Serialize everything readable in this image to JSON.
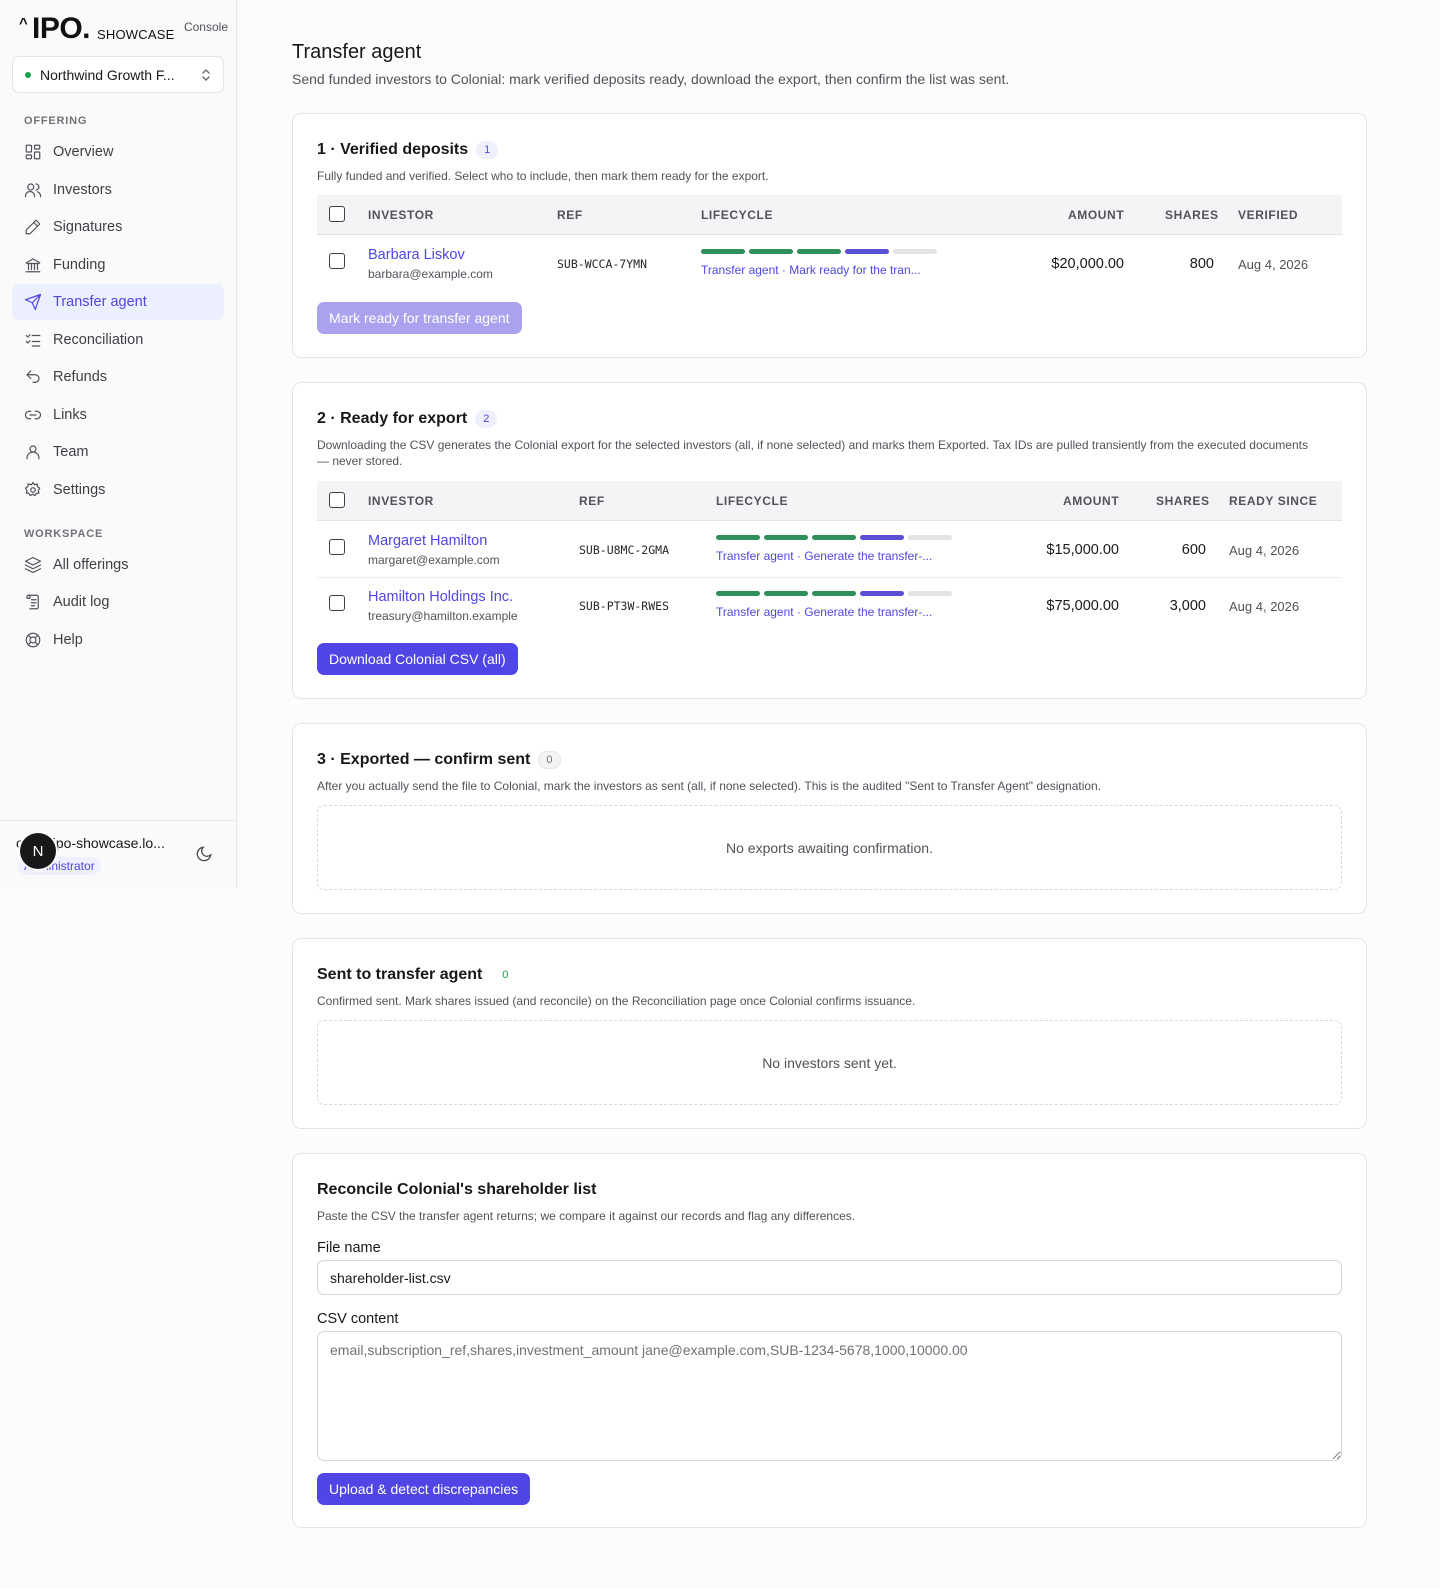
{
  "brand": {
    "mark": "IPO.",
    "caret": "^",
    "showcase": "SHOWCASE",
    "console": "Console"
  },
  "org": {
    "name": "Northwind Growth F..."
  },
  "nav": {
    "offering_label": "OFFERING",
    "offering_items": [
      {
        "label": "Overview",
        "icon": "layout-grid-icon"
      },
      {
        "label": "Investors",
        "icon": "users-icon"
      },
      {
        "label": "Signatures",
        "icon": "pen-icon"
      },
      {
        "label": "Funding",
        "icon": "bank-icon"
      },
      {
        "label": "Transfer agent",
        "icon": "send-icon",
        "active": true
      },
      {
        "label": "Reconciliation",
        "icon": "list-checks-icon"
      },
      {
        "label": "Refunds",
        "icon": "undo-icon"
      },
      {
        "label": "Links",
        "icon": "link-icon"
      },
      {
        "label": "Team",
        "icon": "user-icon"
      },
      {
        "label": "Settings",
        "icon": "gear-icon"
      }
    ],
    "workspace_label": "WORKSPACE",
    "workspace_items": [
      {
        "label": "All offerings",
        "icon": "layers-icon"
      },
      {
        "label": "Audit log",
        "icon": "scroll-icon"
      },
      {
        "label": "Help",
        "icon": "lifebuoy-icon"
      }
    ]
  },
  "user": {
    "initial": "N",
    "email": "ops@ipo-showcase.lo...",
    "role": "Administrator"
  },
  "page": {
    "title": "Transfer agent",
    "subtitle": "Send funded investors to Colonial: mark verified deposits ready, download the export, then confirm the list was sent."
  },
  "verified": {
    "title": "1 · Verified deposits",
    "count": "1",
    "desc": "Fully funded and verified. Select who to include, then mark them ready for the export.",
    "headers": {
      "investor": "INVESTOR",
      "ref": "REF",
      "lifecycle": "LIFECYCLE",
      "amount": "AMOUNT",
      "shares": "SHARES",
      "date": "VERIFIED"
    },
    "rows": [
      {
        "name": "Barbara Liskov",
        "email": "barbara@example.com",
        "ref": "SUB-WCCA-7YMN",
        "lifecycle": "Transfer agent · Mark ready for the tran...",
        "progress_steps_done": 4,
        "progress_steps_total": 5,
        "amount": "$20,000.00",
        "shares": "800",
        "date": "Aug 4, 2026"
      }
    ],
    "button": "Mark ready for transfer agent"
  },
  "ready": {
    "title": "2 · Ready for export",
    "count": "2",
    "desc": "Downloading the CSV generates the Colonial export for the selected investors (all, if none selected) and marks them Exported. Tax IDs are pulled transiently from the executed documents — never stored.",
    "headers": {
      "investor": "INVESTOR",
      "ref": "REF",
      "lifecycle": "LIFECYCLE",
      "amount": "AMOUNT",
      "shares": "SHARES",
      "date": "READY SINCE"
    },
    "rows": [
      {
        "name": "Margaret Hamilton",
        "email": "margaret@example.com",
        "ref": "SUB-U8MC-2GMA",
        "lifecycle": "Transfer agent · Generate the transfer-...",
        "progress_steps_done": 4,
        "progress_steps_total": 5,
        "amount": "$15,000.00",
        "shares": "600",
        "date": "Aug 4, 2026"
      },
      {
        "name": "Hamilton Holdings Inc.",
        "email": "treasury@hamilton.example",
        "ref": "SUB-PT3W-RWES",
        "lifecycle": "Transfer agent · Generate the transfer-...",
        "progress_steps_done": 4,
        "progress_steps_total": 5,
        "amount": "$75,000.00",
        "shares": "3,000",
        "date": "Aug 4, 2026"
      }
    ],
    "button": "Download Colonial CSV (all)"
  },
  "exported": {
    "title": "3 · Exported — confirm sent",
    "count": "0",
    "desc": "After you actually send the file to Colonial, mark the investors as sent (all, if none selected). This is the audited \"Sent to Transfer Agent\" designation.",
    "empty": "No exports awaiting confirmation."
  },
  "sent": {
    "title": "Sent to transfer agent",
    "count": "0",
    "desc": "Confirmed sent. Mark shares issued (and reconcile) on the Reconciliation page once Colonial confirms issuance.",
    "empty": "No investors sent yet."
  },
  "reconcile": {
    "title": "Reconcile Colonial's shareholder list",
    "desc": "Paste the CSV the transfer agent returns; we compare it against our records and flag any differences.",
    "file_label": "File name",
    "file_value": "shareholder-list.csv",
    "csv_label": "CSV content",
    "csv_placeholder": "email,subscription_ref,shares,investment_amount jane@example.com,SUB-1234-5678,1000,10000.00",
    "button": "Upload & detect discrepancies"
  },
  "colors": {
    "accent": "#4f46e5",
    "progress_done": "#2f8f5b",
    "progress_current": "#5b4fd6",
    "status_ok": "#16a34a"
  }
}
